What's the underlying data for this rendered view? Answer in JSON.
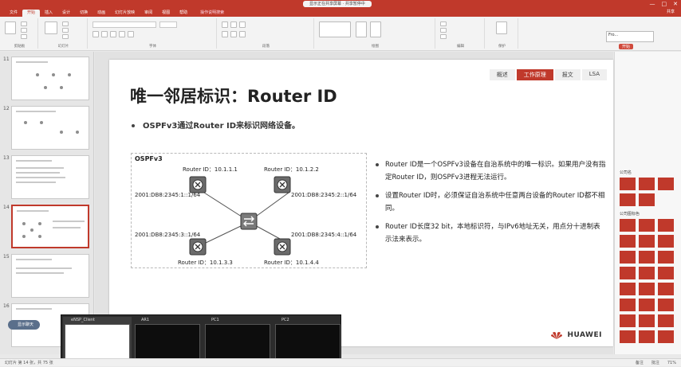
{
  "app": {
    "share_pill": "显示正在共享屏幕 · 共享暂停中",
    "window_controls": [
      "—",
      "□",
      "✕"
    ]
  },
  "ribbon_tabs": {
    "tabs": [
      "文件",
      "开始",
      "插入",
      "设计",
      "切换",
      "动画",
      "幻灯片放映",
      "审阅",
      "视图",
      "帮助"
    ],
    "active": "开始",
    "tell_me": "操作说明搜索",
    "share": "共享"
  },
  "ribbon": {
    "groups": [
      "剪贴板",
      "幻灯片",
      "字体",
      "段落",
      "绘图",
      "编辑",
      "保护"
    ],
    "user_mini_line1": "Fro...",
    "start_btn": "开始"
  },
  "thumbnails": {
    "numbers": [
      "11",
      "12",
      "13",
      "14",
      "15",
      "16"
    ],
    "active_index": 3
  },
  "slide": {
    "nav_tabs": [
      "概述",
      "工作原理",
      "报文",
      "LSA"
    ],
    "nav_active": 1,
    "title": "唯一邻居标识：Router ID",
    "bullet": "OSPFv3通过Router ID来标识网络设备。",
    "diagram": {
      "box_label": "OSPFv3",
      "router_ids": [
        "Router ID：10.1.1.1",
        "Router ID：10.1.2.2",
        "Router ID：10.1.3.3",
        "Router ID：10.1.4.4"
      ],
      "addresses": [
        "2001:DB8:2345:1::1/64",
        "2001:DB8:2345:2::1/64",
        "2001:DB8:2345:3::1/64",
        "2001:DB8:2345:4::1/64"
      ]
    },
    "notes": [
      "Router ID是一个OSPFv3设备在自治系统中的唯一标识。如果用户没有指定Router ID，则OSPFv3进程无法运行。",
      "设置Router ID时，必须保证自治系统中任意两台设备的Router ID都不相同。",
      "Router ID长度32 bit，本地标识符，与IPv6地址无关，用点分十进制表示法来表示。"
    ],
    "brand": "HUAWEI"
  },
  "right_panel": {
    "head1": "公司名",
    "head2": "公司图标色"
  },
  "taskbar_preview": {
    "items": [
      "eNSP_Client",
      "AR1",
      "PC1",
      "PC2"
    ],
    "active_index": 0
  },
  "chat_pill": "显示聊天",
  "statusbar": {
    "left": "幻灯片 第 14 张，共 75 张",
    "zoom": "71%",
    "notes_label": "备注",
    "comments_label": "批注"
  },
  "colors": {
    "accent": "#c0392b",
    "slide_bg": "#ffffff"
  }
}
